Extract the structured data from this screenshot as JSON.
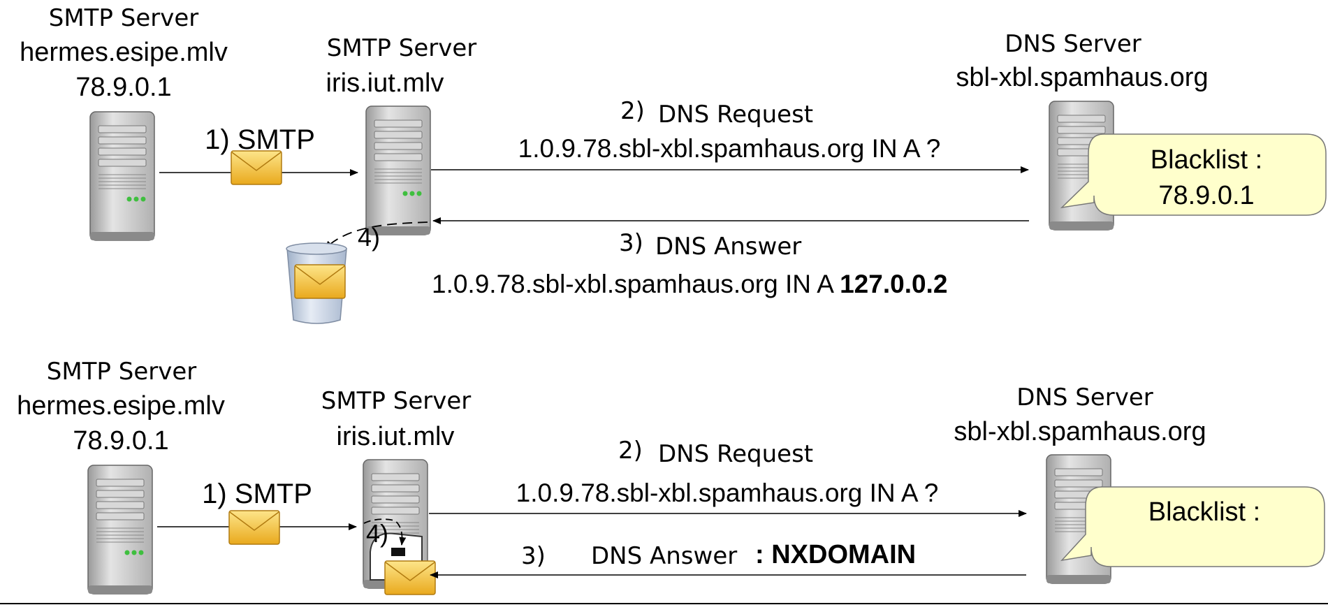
{
  "top": {
    "src": {
      "title": "SMTP Server",
      "host": "hermes.esipe.mlv",
      "ip": "78.9.0.1"
    },
    "mid": {
      "title": "SMTP Server",
      "host": "iris.iut.mlv"
    },
    "dns": {
      "title": "DNS Server",
      "host": "sbl-xbl.spamhaus.org"
    },
    "step1": "1) SMTP",
    "step2_num": "2)",
    "step2_label": "DNS Request",
    "query": "1.0.9.78.sbl-xbl.spamhaus.org IN A ?",
    "step3_num": "3)",
    "step3_label": "DNS Answer",
    "answer_prefix": "1.0.9.78.sbl-xbl.spamhaus.org IN A ",
    "answer_value": "127.0.0.2",
    "step4": "4)",
    "blacklist_title": "Blacklist :",
    "blacklist_ip": "78.9.0.1"
  },
  "bottom": {
    "src": {
      "title": "SMTP Server",
      "host": "hermes.esipe.mlv",
      "ip": "78.9.0.1"
    },
    "mid": {
      "title": "SMTP Server",
      "host": "iris.iut.mlv"
    },
    "dns": {
      "title": "DNS Server",
      "host": "sbl-xbl.spamhaus.org"
    },
    "step1": "1) SMTP",
    "step2_num": "2)",
    "step2_label": "DNS Request",
    "query": "1.0.9.78.sbl-xbl.spamhaus.org IN A ?",
    "step3_num": "3)",
    "step3_label": "DNS Answer",
    "answer_value": ": NXDOMAIN",
    "step4": "4)",
    "blacklist_title": "Blacklist :"
  },
  "colors": {
    "server_body": "#c9c9c9",
    "server_dark": "#8a8a8a",
    "led": "#3fbf3f",
    "envelope": "#f5c542",
    "callout": "#ffffcc",
    "bin": "#c6d3e6"
  }
}
